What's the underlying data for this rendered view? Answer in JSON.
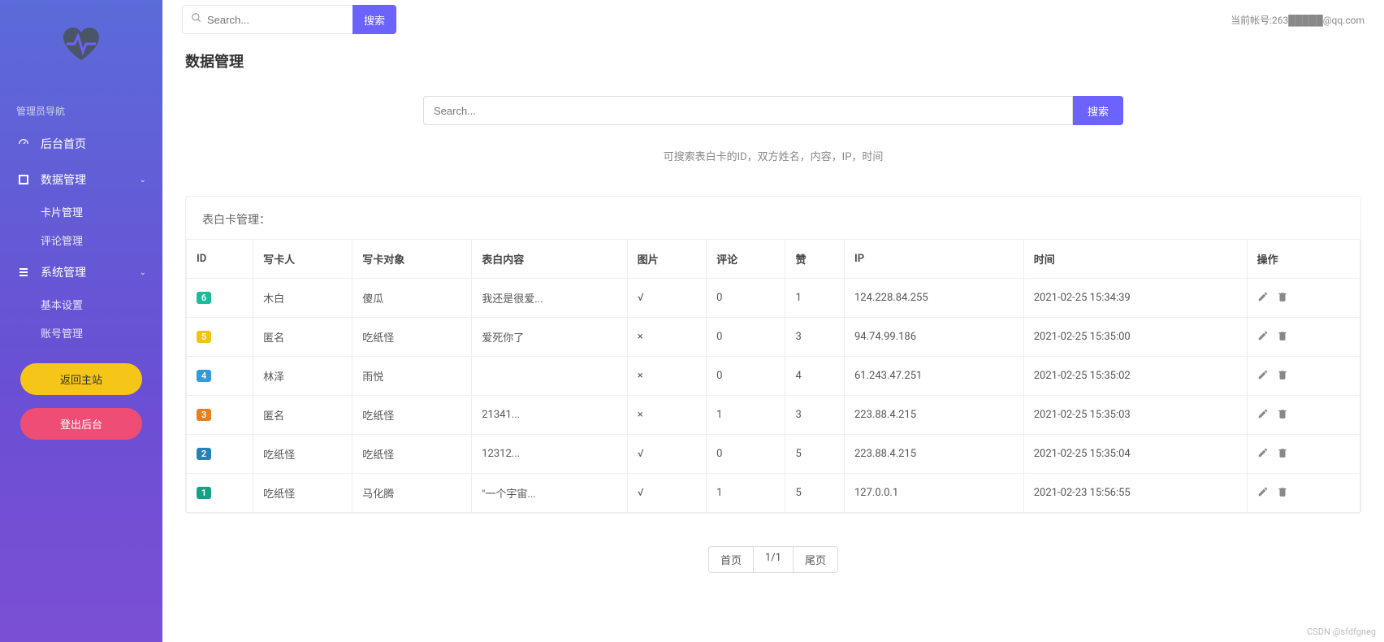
{
  "header": {
    "search_placeholder": "Search...",
    "search_button": "搜索",
    "account_prefix": "当前帐号:",
    "account_value": "263█████@qq.com"
  },
  "sidebar": {
    "nav_header": "管理员导航",
    "home": "后台首页",
    "data_mgmt": "数据管理",
    "card_mgmt": "卡片管理",
    "comment_mgmt": "评论管理",
    "sys_mgmt": "系统管理",
    "basic_settings": "基本设置",
    "account_mgmt": "账号管理",
    "back_main": "返回主站",
    "logout": "登出后台"
  },
  "page": {
    "title": "数据管理",
    "main_search_placeholder": "Search...",
    "main_search_button": "搜索",
    "search_hint": "可搜索表白卡的ID，双方姓名，内容，IP，时间",
    "section_title": "表白卡管理：",
    "columns": {
      "id": "ID",
      "writer": "写卡人",
      "target": "写卡对象",
      "content": "表白内容",
      "image": "图片",
      "comment": "评论",
      "like": "赞",
      "ip": "IP",
      "time": "时间",
      "action": "操作"
    },
    "rows": [
      {
        "id": "6",
        "badge": "bg-green",
        "writer": "木白",
        "target": "傻瓜",
        "content": "我还是很爱...",
        "image": "√",
        "comment": "0",
        "like": "1",
        "ip": "124.228.84.255",
        "time": "2021-02-25 15:34:39"
      },
      {
        "id": "5",
        "badge": "bg-yellow",
        "writer": "匿名",
        "target": "吃纸怪",
        "content": "爱死你了",
        "image": "×",
        "comment": "0",
        "like": "3",
        "ip": "94.74.99.186",
        "time": "2021-02-25 15:35:00"
      },
      {
        "id": "4",
        "badge": "bg-blue",
        "writer": "林泽",
        "target": "雨悦",
        "content": "",
        "image": "×",
        "comment": "0",
        "like": "4",
        "ip": "61.243.47.251",
        "time": "2021-02-25 15:35:02"
      },
      {
        "id": "3",
        "badge": "bg-orange",
        "writer": "匿名",
        "target": "吃纸怪",
        "content": "21341...",
        "image": "×",
        "comment": "1",
        "like": "3",
        "ip": "223.88.4.215",
        "time": "2021-02-25 15:35:03"
      },
      {
        "id": "2",
        "badge": "bg-blue2",
        "writer": "吃纸怪",
        "target": "吃纸怪",
        "content": "12312...",
        "image": "√",
        "comment": "0",
        "like": "5",
        "ip": "223.88.4.215",
        "time": "2021-02-25 15:35:04"
      },
      {
        "id": "1",
        "badge": "bg-teal",
        "writer": "吃纸怪",
        "target": "马化腾",
        "content": "\"一个宇宙...",
        "image": "√",
        "comment": "1",
        "like": "5",
        "ip": "127.0.0.1",
        "time": "2021-02-23 15:56:55"
      }
    ],
    "pagination": {
      "first": "首页",
      "info": "1/1",
      "last": "尾页"
    }
  },
  "watermark": "CSDN @sfdfgneg"
}
